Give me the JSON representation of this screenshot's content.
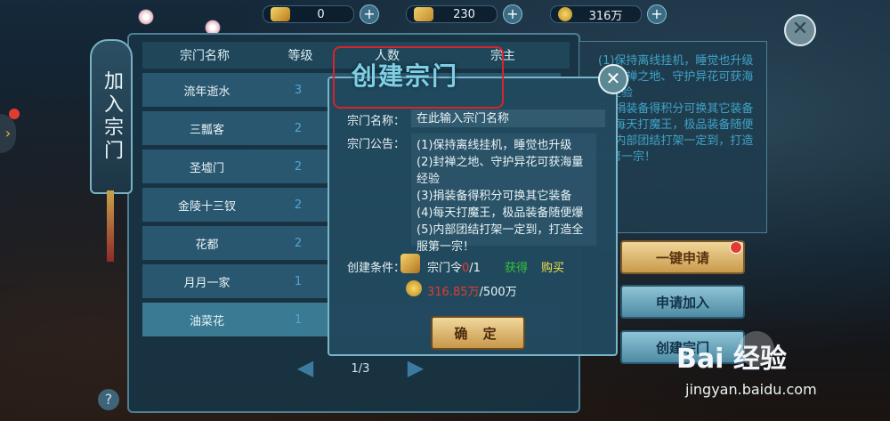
{
  "currency": [
    {
      "icon": "gold-ingot-icon",
      "value": "0"
    },
    {
      "icon": "silver-ingot-icon",
      "value": "230"
    },
    {
      "icon": "coin-icon",
      "value": "316万"
    }
  ],
  "side_tab": {
    "label": "加入宗门"
  },
  "table": {
    "headers": [
      "宗门名称",
      "等级",
      "人数",
      "宗主"
    ],
    "rows": [
      {
        "name": "流年逝水",
        "level": "3"
      },
      {
        "name": "三瓢客",
        "level": "2"
      },
      {
        "name": "圣墟门",
        "level": "2"
      },
      {
        "name": "金陵十三钗",
        "level": "2"
      },
      {
        "name": "花都",
        "level": "2"
      },
      {
        "name": "月月一家",
        "level": "1"
      },
      {
        "name": "油菜花",
        "level": "1"
      }
    ],
    "page": "1/3"
  },
  "right_panel": {
    "text": "(1)保持离线挂机，睡觉也升级\n(2)封禅之地、守护异花可获海量经验\n(3)捐装备得积分可换其它装备\n(4)每天打魔王，极品装备随便\n(5)内部团结打架一定到，打造\n服第一宗！",
    "buttons": {
      "apply_all": "一键申请",
      "apply_join": "申请加入",
      "create": "创建宗门"
    }
  },
  "modal": {
    "title": "创建宗门",
    "name_label": "宗门名称：",
    "name_placeholder": "在此输入宗门名称",
    "notice_label": "宗门公告：",
    "notice_text": "(1)保持离线挂机，睡觉也升级\n(2)封禅之地、守护异花可获海量经验\n(3)捐装备得积分可换其它装备\n(4)每天打魔王，极品装备随便爆\n(5)内部团结打架一定到，打造全服第一宗！",
    "condition_label": "创建条件：",
    "token_name": "宗门令",
    "token_have": "0",
    "token_need": "/1",
    "get_link": "获得",
    "buy_link": "购买",
    "coin_have": "316.85万",
    "coin_need": "/500万",
    "confirm": "确 定"
  },
  "watermark": {
    "brand": "Bai 经验",
    "url": "jingyan.baidu.com"
  },
  "colors": {
    "highlight_red": "#d8242a",
    "gold_button": "#e6c27a",
    "accent_blue": "#4fa6d6",
    "cost_red": "#e23b2f",
    "link_green": "#34c23a",
    "link_yellow": "#f2e14b"
  }
}
